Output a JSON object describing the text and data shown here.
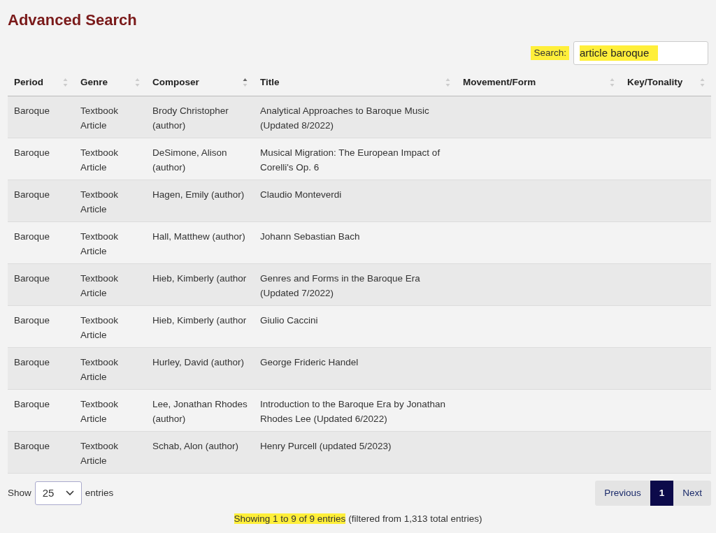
{
  "page": {
    "title": "Advanced Search"
  },
  "search": {
    "label": "Search:",
    "label_highlighted": true,
    "value": "article baroque",
    "value_highlighted": true
  },
  "table": {
    "columns": [
      {
        "label": "Period",
        "sorted": false
      },
      {
        "label": "Genre",
        "sorted": false
      },
      {
        "label": "Composer",
        "sorted": true
      },
      {
        "label": "Title",
        "sorted": false
      },
      {
        "label": "Movement/Form",
        "sorted": false
      },
      {
        "label": "Key/Tonality",
        "sorted": false
      }
    ],
    "rows": [
      [
        "Baroque",
        "Textbook Article",
        "Brody Christopher (author)",
        "Analytical Approaches to Baroque Music (Updated 8/2022)",
        "",
        ""
      ],
      [
        "Baroque",
        "Textbook Article",
        "DeSimone, Alison (author)",
        "Musical Migration: The European Impact of Corelli's Op. 6",
        "",
        ""
      ],
      [
        "Baroque",
        "Textbook Article",
        "Hagen, Emily (author)",
        "Claudio Monteverdi",
        "",
        ""
      ],
      [
        "Baroque",
        "Textbook Article",
        "Hall, Matthew (author)",
        "Johann Sebastian Bach",
        "",
        ""
      ],
      [
        "Baroque",
        "Textbook Article",
        "Hieb, Kimberly (author",
        "Genres and Forms in the Baroque Era (Updated 7/2022)",
        "",
        ""
      ],
      [
        "Baroque",
        "Textbook Article",
        "Hieb, Kimberly (author",
        "Giulio Caccini",
        "",
        ""
      ],
      [
        "Baroque",
        "Textbook Article",
        "Hurley, David (author)",
        "George Frideric Handel",
        "",
        ""
      ],
      [
        "Baroque",
        "Textbook Article",
        "Lee, Jonathan Rhodes (author)",
        "Introduction to the Baroque Era by Jonathan Rhodes Lee (Updated 6/2022)",
        "",
        ""
      ],
      [
        "Baroque",
        "Textbook Article",
        "Schab, Alon (author)",
        "Henry Purcell (updated 5/2023)",
        "",
        ""
      ]
    ]
  },
  "length": {
    "before": "Show",
    "value": "25",
    "after": "entries"
  },
  "pagination": [
    {
      "label": "Previous",
      "kind": "nav",
      "selected": false
    },
    {
      "label": "1",
      "kind": "page",
      "selected": true
    },
    {
      "label": "Next",
      "kind": "nav",
      "selected": false
    }
  ],
  "info": {
    "text": "Showing 1 to 9 of 9 entries",
    "highlighted": true,
    "note": "(filtered from 1,313 total entries)"
  }
}
